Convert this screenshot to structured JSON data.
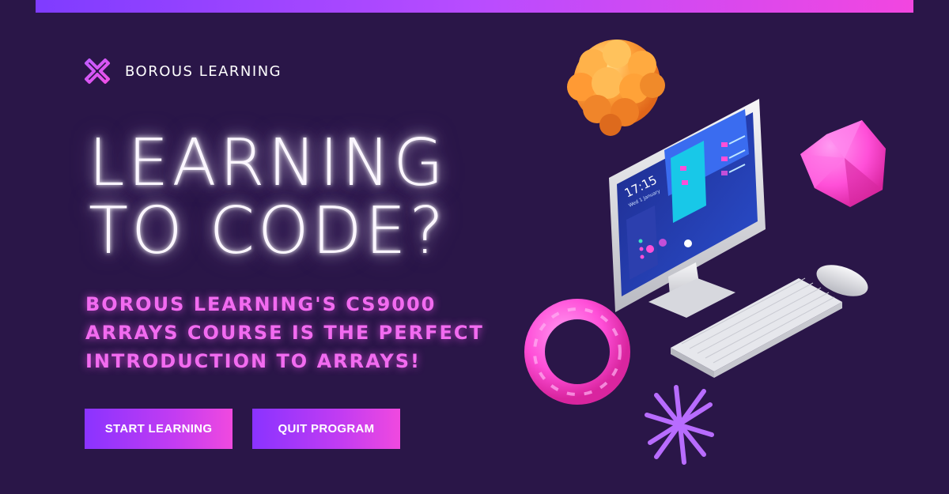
{
  "colors": {
    "background": "#2a1648",
    "accent_pink": "#f26bf0",
    "accent_purple": "#8a33ff",
    "headline": "#fbf6ff"
  },
  "brand": {
    "logo_icon": "borous-x-logo-icon",
    "name": "BOROUS LEARNING"
  },
  "headline": {
    "line1": "LEARNING",
    "line2": "TO CODE?"
  },
  "subheadline": {
    "line1": "BOROUS LEARNING'S CS9000",
    "line2": "ARRAYS COURSE IS THE PERFECT",
    "line3": "INTRODUCTION TO ARRAYS!"
  },
  "buttons": {
    "start_label": "START LEARNING",
    "quit_label": "QUIT PROGRAM"
  },
  "illustration": {
    "screen_clock": "17:15",
    "screen_date": "Wed 1 January"
  }
}
